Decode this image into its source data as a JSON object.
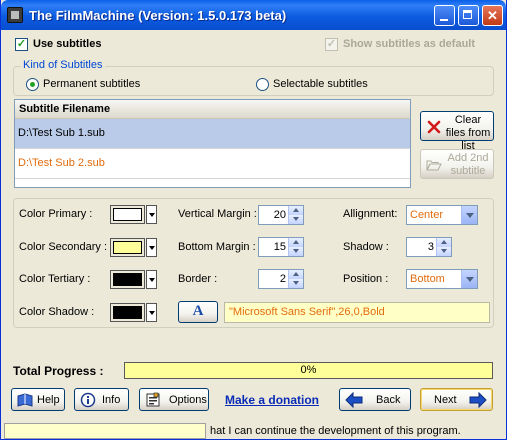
{
  "window": {
    "title": "The FilmMachine   (Version: 1.5.0.173 beta)"
  },
  "subtitles": {
    "use_subtitles_label": "Use subtitles",
    "use_subtitles_checked": true,
    "show_default_label": "Show subtitles as default",
    "show_default_checked": true,
    "kind_legend": "Kind of Subtitles",
    "permanent_label": "Permanent subtitles",
    "selectable_label": "Selectable subtitles",
    "selected_kind": "permanent"
  },
  "file_list": {
    "header": "Subtitle Filename",
    "items": [
      {
        "name": "D:\\Test Sub 1.sub",
        "selected": true
      },
      {
        "name": "D:\\Test Sub 2.sub",
        "selected": false
      }
    ],
    "clear_button": "Clear files from list",
    "add_button": "Add 2nd subtitle"
  },
  "style": {
    "color_primary_label": "Color Primary :",
    "color_secondary_label": "Color Secondary :",
    "color_tertiary_label": "Color Tertiary :",
    "color_shadow_label": "Color Shadow :",
    "color_primary": "#ffffff",
    "color_secondary": "#ffff99",
    "color_tertiary": "#000000",
    "color_shadow": "#000000",
    "vertical_margin_label": "Vertical Margin :",
    "vertical_margin": "20",
    "bottom_margin_label": "Bottom Margin :",
    "bottom_margin": "15",
    "border_label": "Border :",
    "border": "2",
    "alignment_label": "Allignment:",
    "alignment": "Center",
    "shadow_label": "Shadow :",
    "shadow": "3",
    "position_label": "Position :",
    "position": "Bottom",
    "font_button": "A",
    "font": "\"Microsoft Sans Serif\",26,0,Bold"
  },
  "progress": {
    "label": "Total Progress :",
    "value": 0,
    "text": "0%"
  },
  "buttons": {
    "help": "Help",
    "info": "Info",
    "options": "Options",
    "donation": "Make a donation",
    "back": "Back",
    "next": "Next"
  },
  "status_bar": {
    "text": "hat I can continue the development of this program."
  },
  "icons": {
    "app": "film-icon",
    "help": "book-icon",
    "info": "info-icon",
    "options": "options-icon",
    "back": "arrow-left-icon",
    "next": "arrow-right-icon",
    "clear": "red-x-icon",
    "add": "folder-open-icon"
  },
  "colors": {
    "accent_blue": "#0a4ecf",
    "value_orange": "#e26c0e",
    "check_green": "#21a121",
    "link_blue": "#0a2bb6"
  }
}
